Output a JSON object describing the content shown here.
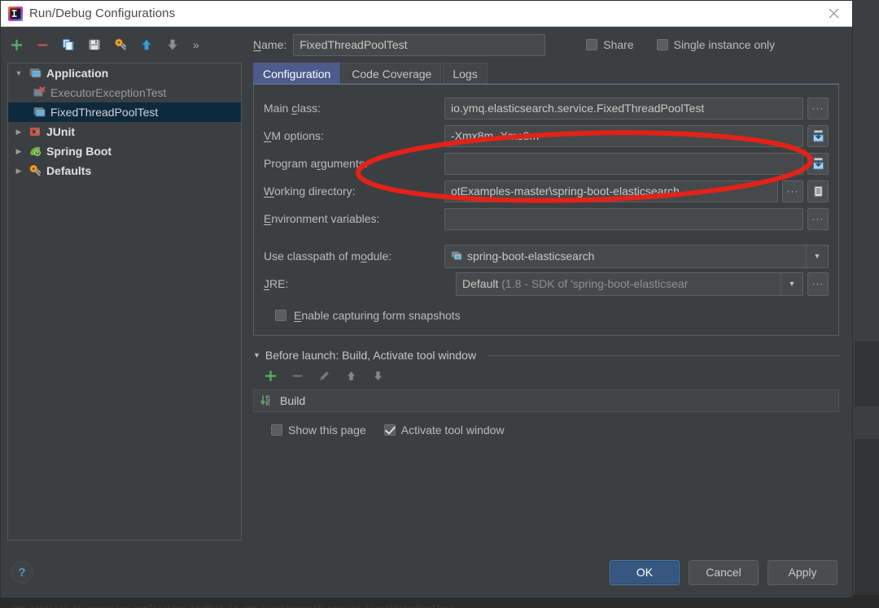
{
  "window": {
    "title": "Run/Debug Configurations",
    "logo_icon": "intellij-idea-logo-icon",
    "close_icon": "close-icon"
  },
  "toolbar": {
    "buttons": [
      {
        "name": "add",
        "icon": "plus-icon",
        "glyph": "+"
      },
      {
        "name": "remove",
        "icon": "minus-icon",
        "glyph": "–"
      },
      {
        "name": "copy",
        "icon": "copy-configuration-icon",
        "glyph": ""
      },
      {
        "name": "save",
        "icon": "save-icon",
        "glyph": ""
      },
      {
        "name": "edit-defaults",
        "icon": "wrench-gear-icon",
        "glyph": ""
      },
      {
        "name": "move-up",
        "icon": "arrow-up-icon",
        "glyph": ""
      },
      {
        "name": "move-down",
        "icon": "arrow-down-icon",
        "glyph": ""
      }
    ],
    "overflow_label": "»"
  },
  "name_row": {
    "label": "Name:",
    "value": "FixedThreadPoolTest",
    "share": {
      "label": "Share",
      "checked": false
    },
    "single_instance": {
      "label": "Single instance only",
      "checked": false
    }
  },
  "tree": {
    "items": [
      {
        "label": "Application",
        "icon": "application-folder-icon",
        "twisty": "expanded",
        "level": 0,
        "bold": true,
        "selected": false,
        "dim": false
      },
      {
        "label": "ExecutorExceptionTest",
        "icon": "application-error-icon",
        "twisty": "none",
        "level": 1,
        "bold": false,
        "selected": false,
        "dim": true
      },
      {
        "label": "FixedThreadPoolTest",
        "icon": "application-run-icon",
        "twisty": "none",
        "level": 1,
        "bold": false,
        "selected": true,
        "dim": false
      },
      {
        "label": "JUnit",
        "icon": "junit-icon",
        "twisty": "collapsed",
        "level": 0,
        "bold": true,
        "selected": false,
        "dim": false
      },
      {
        "label": "Spring Boot",
        "icon": "spring-boot-leaf-icon",
        "twisty": "collapsed",
        "level": 0,
        "bold": true,
        "selected": false,
        "dim": false
      },
      {
        "label": "Defaults",
        "icon": "wrench-gear-icon",
        "twisty": "collapsed",
        "level": 0,
        "bold": true,
        "selected": false,
        "dim": false
      }
    ]
  },
  "tabs": [
    {
      "label": "Configuration",
      "active": true
    },
    {
      "label": "Code Coverage",
      "active": false
    },
    {
      "label": "Logs",
      "active": false
    }
  ],
  "config": {
    "main_class": {
      "label": "Main class:",
      "value": "io.ymq.elasticsearch.service.FixedThreadPoolTest",
      "browse_icon": "ellipsis-icon"
    },
    "vm_options": {
      "label": "VM options:",
      "value": "-Xmx8m -Xms8m",
      "expand_icon": "expand-editor-icon"
    },
    "program_arguments": {
      "label": "Program arguments:",
      "value": "",
      "expand_icon": "expand-editor-icon"
    },
    "working_directory": {
      "label": "Working directory:",
      "value": "otExamples-master\\spring-boot-elasticsearch",
      "browse_icon": "ellipsis-icon",
      "macro_icon": "macros-list-icon"
    },
    "environment_variables": {
      "label": "Environment variables:",
      "value": "",
      "browse_icon": "ellipsis-icon"
    },
    "classpath_module": {
      "label": "Use classpath of module:",
      "value": "spring-boot-elasticsearch",
      "icon": "module-icon",
      "dropdown_icon": "chevron-down-icon"
    },
    "jre": {
      "label": "JRE:",
      "value": "Default",
      "value_hint": "(1.8 - SDK of 'spring-boot-elasticsear",
      "dropdown_icon": "chevron-down-icon",
      "browse_icon": "ellipsis-icon"
    },
    "form_snapshots": {
      "label": "Enable capturing form snapshots",
      "checked": false
    }
  },
  "before_launch": {
    "header": "Before launch: Build, Activate tool window",
    "twisty": "expanded",
    "tools": [
      {
        "name": "add-task",
        "icon": "plus-icon",
        "enabled": true
      },
      {
        "name": "remove-task",
        "icon": "minus-icon",
        "enabled": false
      },
      {
        "name": "edit-task",
        "icon": "pencil-icon",
        "enabled": false
      },
      {
        "name": "move-task-up",
        "icon": "arrow-up-icon",
        "enabled": false
      },
      {
        "name": "move-task-down",
        "icon": "arrow-down-icon",
        "enabled": false
      }
    ],
    "tasks": [
      {
        "label": "Build",
        "icon": "build-compile-icon"
      }
    ],
    "show_this_page": {
      "label": "Show this page",
      "checked": false
    },
    "activate_tool_window": {
      "label": "Activate tool window",
      "checked": true
    }
  },
  "footer": {
    "help_icon": "help-question-icon",
    "ok": "OK",
    "cancel": "Cancel",
    "apply": "Apply"
  },
  "annotation": {
    "shape": "red-ellipse-highlight",
    "color": "#e32219",
    "target": "VM options and Program arguments rows"
  },
  "colors": {
    "dialog_bg": "#3c3f41",
    "titlebar_bg": "#ffffff",
    "field_bg": "#45494a",
    "tab_active": "#4b5b8a",
    "tree_selection": "#0d293e",
    "default_button": "#365880",
    "annotation_red": "#e32219"
  }
}
